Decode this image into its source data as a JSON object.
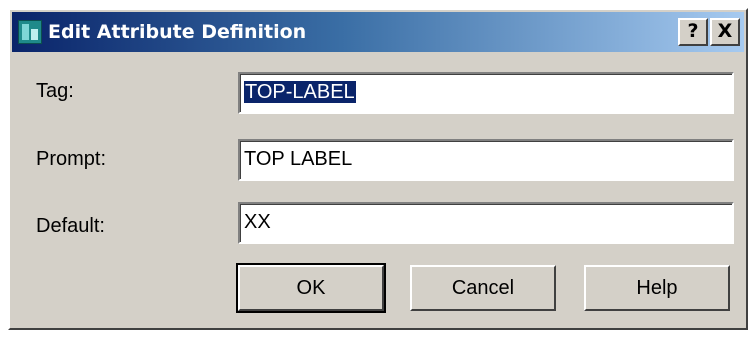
{
  "window": {
    "title": "Edit Attribute Definition",
    "help_button": "?",
    "close_button": "X"
  },
  "fields": {
    "tag": {
      "label": "Tag:",
      "value": "TOP-LABEL"
    },
    "prompt": {
      "label": "Prompt:",
      "value": "TOP LABEL"
    },
    "default": {
      "label": "Default:",
      "value": "XX"
    }
  },
  "buttons": {
    "ok": "OK",
    "cancel": "Cancel",
    "help": "Help"
  },
  "colors": {
    "titlebar_start": "#0a246a",
    "titlebar_end": "#a6caf0",
    "face": "#d4d0c8",
    "selection": "#0a246a"
  },
  "icons": {
    "app": "attribute-definition-icon",
    "help": "help-icon",
    "close": "close-icon"
  }
}
